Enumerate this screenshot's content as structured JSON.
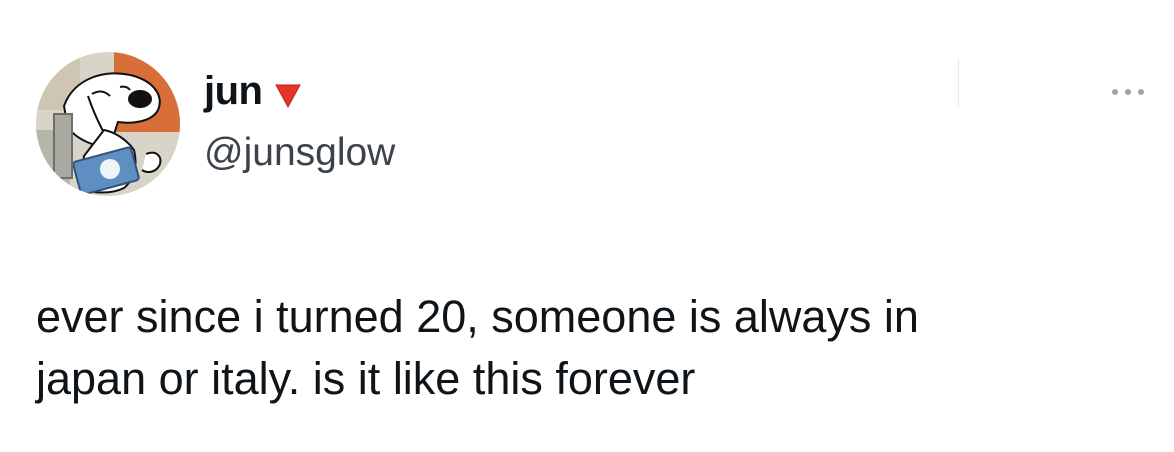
{
  "author": {
    "display_name": "jun",
    "handle": "@junsglow",
    "name_emoji": "red-triangle-down-icon"
  },
  "tweet": {
    "text": "ever since i turned 20, someone is always in\njapan or italy. is it like this forever"
  },
  "icons": {
    "more": "more-horizontal-icon",
    "avatar": "snoopy-avatar"
  },
  "colors": {
    "name": "#0f1419",
    "handle": "#3b4249",
    "text": "#0f1419",
    "emoji": "#e4342d",
    "more_dots": "#9aa4ad"
  }
}
